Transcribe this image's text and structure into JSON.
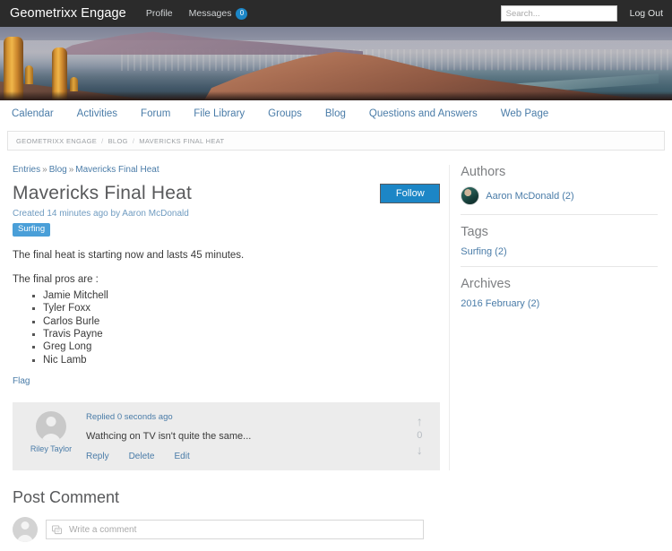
{
  "topbar": {
    "brand": "Geometrixx Engage",
    "nav": [
      {
        "label": "Profile",
        "name": "profile"
      },
      {
        "label": "Messages",
        "name": "messages",
        "badge": "0"
      }
    ],
    "search_placeholder": "Search...",
    "search_value": "",
    "logout_label": "Log Out",
    "background": "#2b2b2b",
    "badge_color": "#1c86c6"
  },
  "mainnav": {
    "items": [
      {
        "label": "Calendar",
        "name": "calendar"
      },
      {
        "label": "Activities",
        "name": "activities"
      },
      {
        "label": "Forum",
        "name": "forum"
      },
      {
        "label": "File Library",
        "name": "file-library"
      },
      {
        "label": "Groups",
        "name": "groups"
      },
      {
        "label": "Blog",
        "name": "blog"
      },
      {
        "label": "Questions and Answers",
        "name": "questions-and-answers"
      },
      {
        "label": "Web Page",
        "name": "web-page"
      }
    ],
    "link_color": "#4a7ca8"
  },
  "breadcrumb_bar": {
    "items": [
      "GEOMETRIXX ENGAGE",
      "BLOG",
      "MAVERICKS FINAL HEAT"
    ],
    "separator": "/"
  },
  "post": {
    "entries_crumb": {
      "entries": "Entries",
      "arrow1": "»",
      "blog": "Blog",
      "arrow2": "»",
      "current": "Mavericks Final Heat"
    },
    "title": "Mavericks Final Heat",
    "follow_label": "Follow",
    "follow_color": "#1c86c6",
    "meta": "Created 14 minutes ago by Aaron McDonald",
    "tag": "Surfing",
    "tag_color": "#4a9fd8",
    "paragraph1": "The final heat is starting now and lasts 45 minutes.",
    "paragraph2": "The final pros are :",
    "pros": [
      "Jamie Mitchell",
      "Tyler Foxx",
      "Carlos Burle",
      "Travis Payne",
      "Greg Long",
      "Nic Lamb"
    ],
    "flag_label": "Flag"
  },
  "comment": {
    "author": "Riley Taylor",
    "time": "Replied 0 seconds ago",
    "text": "Wathcing on TV isn't quite the same...",
    "actions": [
      {
        "label": "Reply",
        "name": "reply"
      },
      {
        "label": "Delete",
        "name": "delete"
      },
      {
        "label": "Edit",
        "name": "edit"
      }
    ],
    "vote_up": "↑",
    "vote_count": "0",
    "vote_down": "↓",
    "background": "#ececec"
  },
  "post_comment": {
    "title": "Post Comment",
    "placeholder": "Write a comment",
    "value": "",
    "icon": "comment-icon"
  },
  "sidebar": {
    "sections": [
      {
        "name": "authors",
        "heading": "Authors",
        "items": [
          {
            "label": "Aaron McDonald (2)",
            "name": "author-aaron-mcdonald",
            "avatar": true
          }
        ]
      },
      {
        "name": "tags",
        "heading": "Tags",
        "items": [
          {
            "label": "Surfing (2)",
            "name": "tag-surfing",
            "avatar": false
          }
        ]
      },
      {
        "name": "archives",
        "heading": "Archives",
        "items": [
          {
            "label": "2016 February (2)",
            "name": "archive-2016-february",
            "avatar": false
          }
        ]
      }
    ],
    "link_color": "#4a7ca8"
  },
  "hero": {
    "alt": "desert-landscape-banner"
  }
}
